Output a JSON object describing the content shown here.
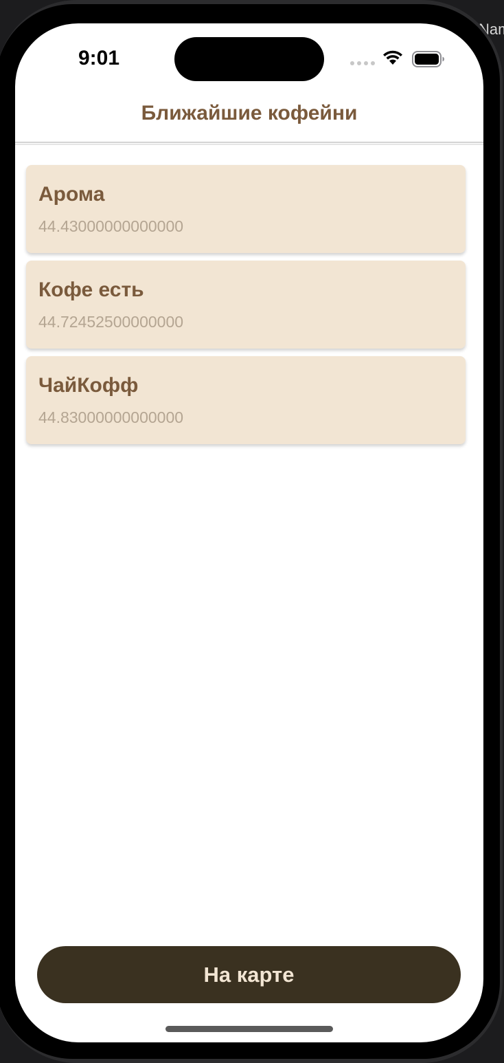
{
  "status_bar": {
    "time": "9:01",
    "icons": [
      "cellular-signal-icon",
      "wifi-icon",
      "battery-icon"
    ]
  },
  "backdrop": {
    "partial_text": "Nam"
  },
  "navigation": {
    "title": "Ближайшие кофейни"
  },
  "cafes": [
    {
      "name": "Арома",
      "value": "44.43000000000000"
    },
    {
      "name": "Кофе есть",
      "value": "44.72452500000000"
    },
    {
      "name": "ЧайКофф",
      "value": "44.83000000000000"
    }
  ],
  "actions": {
    "map_button_label": "На карте"
  },
  "colors": {
    "accent_brown": "#7a5a3c",
    "card_background": "#f2e5d3",
    "card_subtitle": "#b4a592",
    "button_background": "#3a3120",
    "button_text": "#f2e5d3"
  }
}
